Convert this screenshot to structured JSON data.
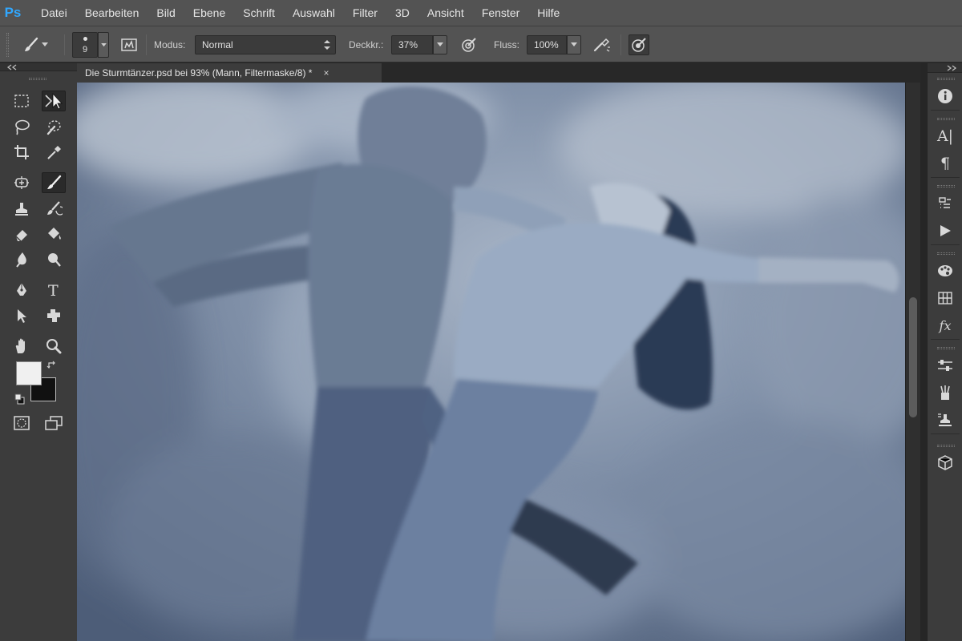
{
  "app": {
    "logo": "Ps",
    "brand_color": "#31a8ff"
  },
  "menu": [
    "Datei",
    "Bearbeiten",
    "Bild",
    "Ebene",
    "Schrift",
    "Auswahl",
    "Filter",
    "3D",
    "Ansicht",
    "Fenster",
    "Hilfe"
  ],
  "options": {
    "brush_size": "9",
    "mode_label": "Modus:",
    "mode_value": "Normal",
    "opacity_label": "Deckkr.:",
    "opacity_value": "37%",
    "flow_label": "Fluss:",
    "flow_value": "100%"
  },
  "document": {
    "tab_title": "Die Sturmtänzer.psd bei 93% (Mann, Filtermaske/8) *",
    "close_glyph": "×"
  },
  "left_tools": [
    "rect-marquee-icon",
    "move-icon",
    "lasso-icon",
    "quick-select-icon",
    "crop-icon",
    "eyedropper-icon",
    "spot-heal-icon",
    "brush-icon",
    "stamp-icon",
    "history-brush-icon",
    "eraser-icon",
    "bucket-icon",
    "blur-icon",
    "dodge-icon",
    "pen-icon",
    "type-icon",
    "path-select-icon",
    "shape-icon",
    "hand-icon",
    "zoom-icon"
  ],
  "active_tool": "brush-icon",
  "colors": {
    "foreground": "#f0f0f0",
    "background": "#111111"
  },
  "right_dock": {
    "groups": [
      [
        "info-icon"
      ],
      [
        "character-icon",
        "paragraph-icon"
      ],
      [
        "actions-icon",
        "play-icon"
      ],
      [
        "color-icon",
        "swatches-icon",
        "styles-icon"
      ],
      [
        "adjustments-icon",
        "brushes-icon",
        "clone-source-icon"
      ],
      [
        "3d-icon"
      ]
    ],
    "labels": {
      "character": "A|",
      "paragraph": "¶",
      "styles": "fx"
    }
  }
}
